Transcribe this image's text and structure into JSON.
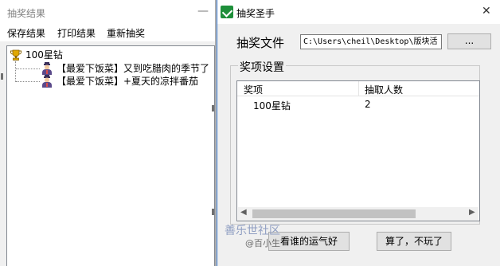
{
  "results_window": {
    "title": "抽奖结果",
    "minimize_glyph": "—",
    "menu": [
      "保存结果",
      "打印结果",
      "重新抽奖"
    ],
    "tree": {
      "root": {
        "label": "100星钻",
        "icon": "trophy-icon"
      },
      "children": [
        {
          "label": "【最爱下饭菜】又到吃腊肉的季节了",
          "icon": "user-avatar-icon"
        },
        {
          "label": "【最爱下饭菜】+夏天的凉拌番茄",
          "icon": "user-avatar-icon"
        }
      ]
    }
  },
  "lottery_window": {
    "title": "抽奖圣手",
    "close_glyph": "✕",
    "file_label": "抽奖文件",
    "file_path": "C:\\Users\\cheil\\Desktop\\版块活",
    "browse_label": "...",
    "group_label": "奖项设置",
    "columns": [
      "奖项",
      "抽取人数"
    ],
    "rows": [
      {
        "prize": "100星钻",
        "count": "2"
      }
    ],
    "scroll_left_glyph": "◀",
    "scroll_right_glyph": "▶",
    "button_go": "看谁的运气好",
    "button_quit": "算了，不玩了"
  },
  "watermark": {
    "main": "善乐世社区",
    "sub": "@百小生"
  },
  "colors": {
    "accent": "#2b6cc4",
    "icon_green": "#1e8f3a",
    "trophy_gold": "#e0a800"
  }
}
